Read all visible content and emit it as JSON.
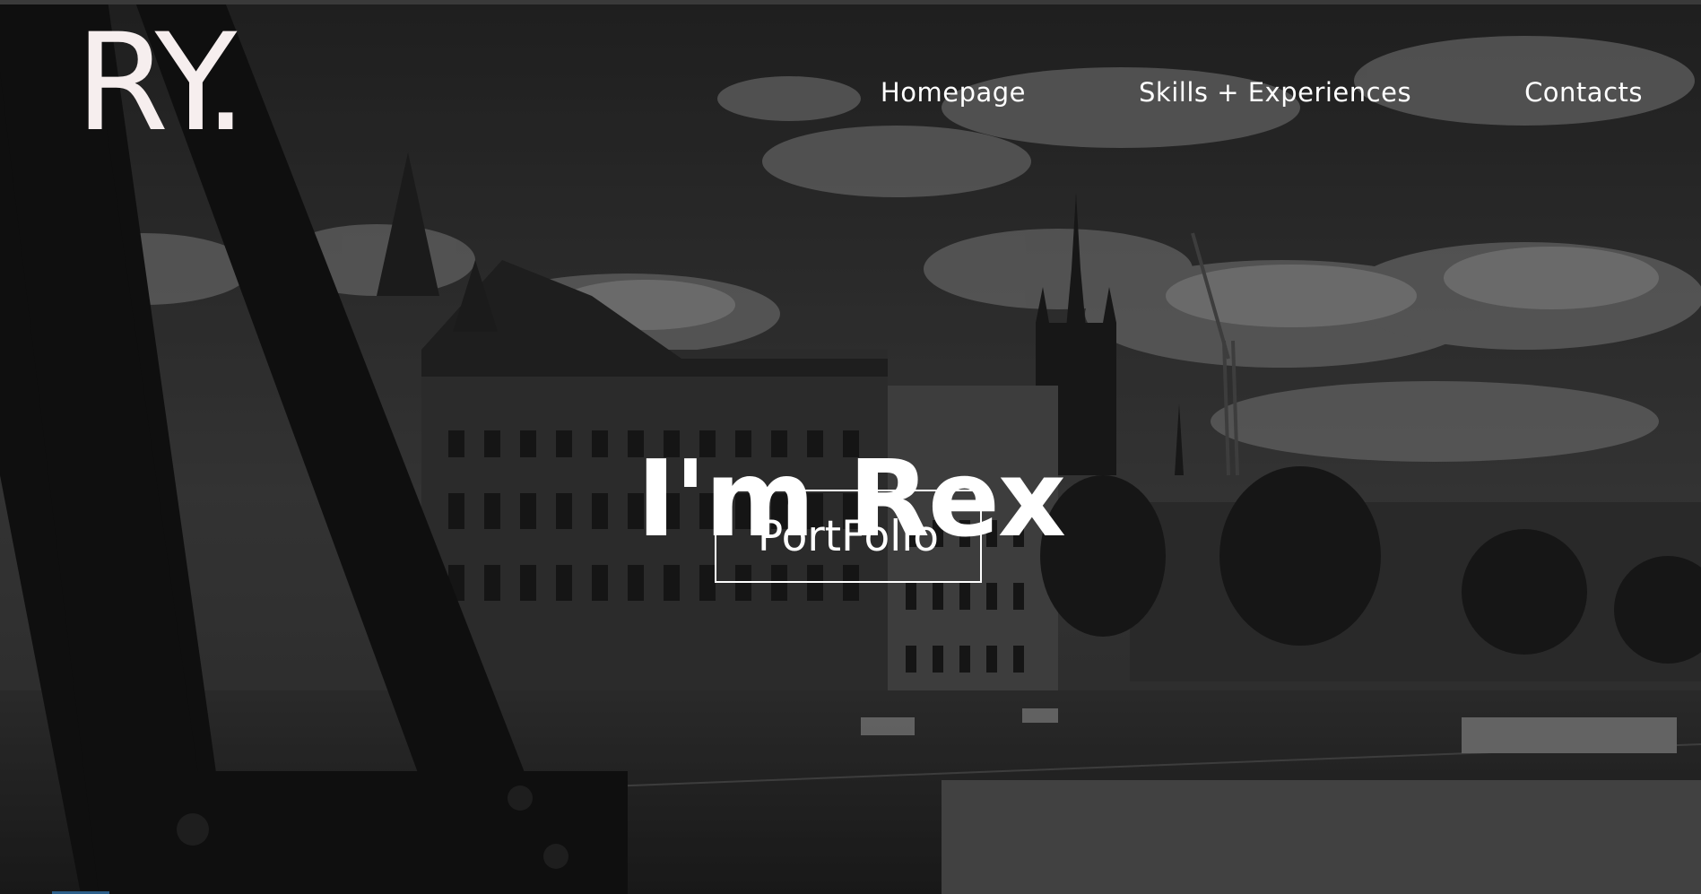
{
  "logo": {
    "text": "RY."
  },
  "nav": {
    "items": [
      {
        "label": "Homepage"
      },
      {
        "label": "Skills + Experiences"
      },
      {
        "label": "Contacts"
      }
    ]
  },
  "hero": {
    "title": "I'm Rex",
    "button_label": "PortFolio",
    "background": "grayscale-city-photo"
  },
  "colors": {
    "logo": "#f6eeee",
    "text": "#ffffff",
    "accent": "#2d5f8a"
  }
}
